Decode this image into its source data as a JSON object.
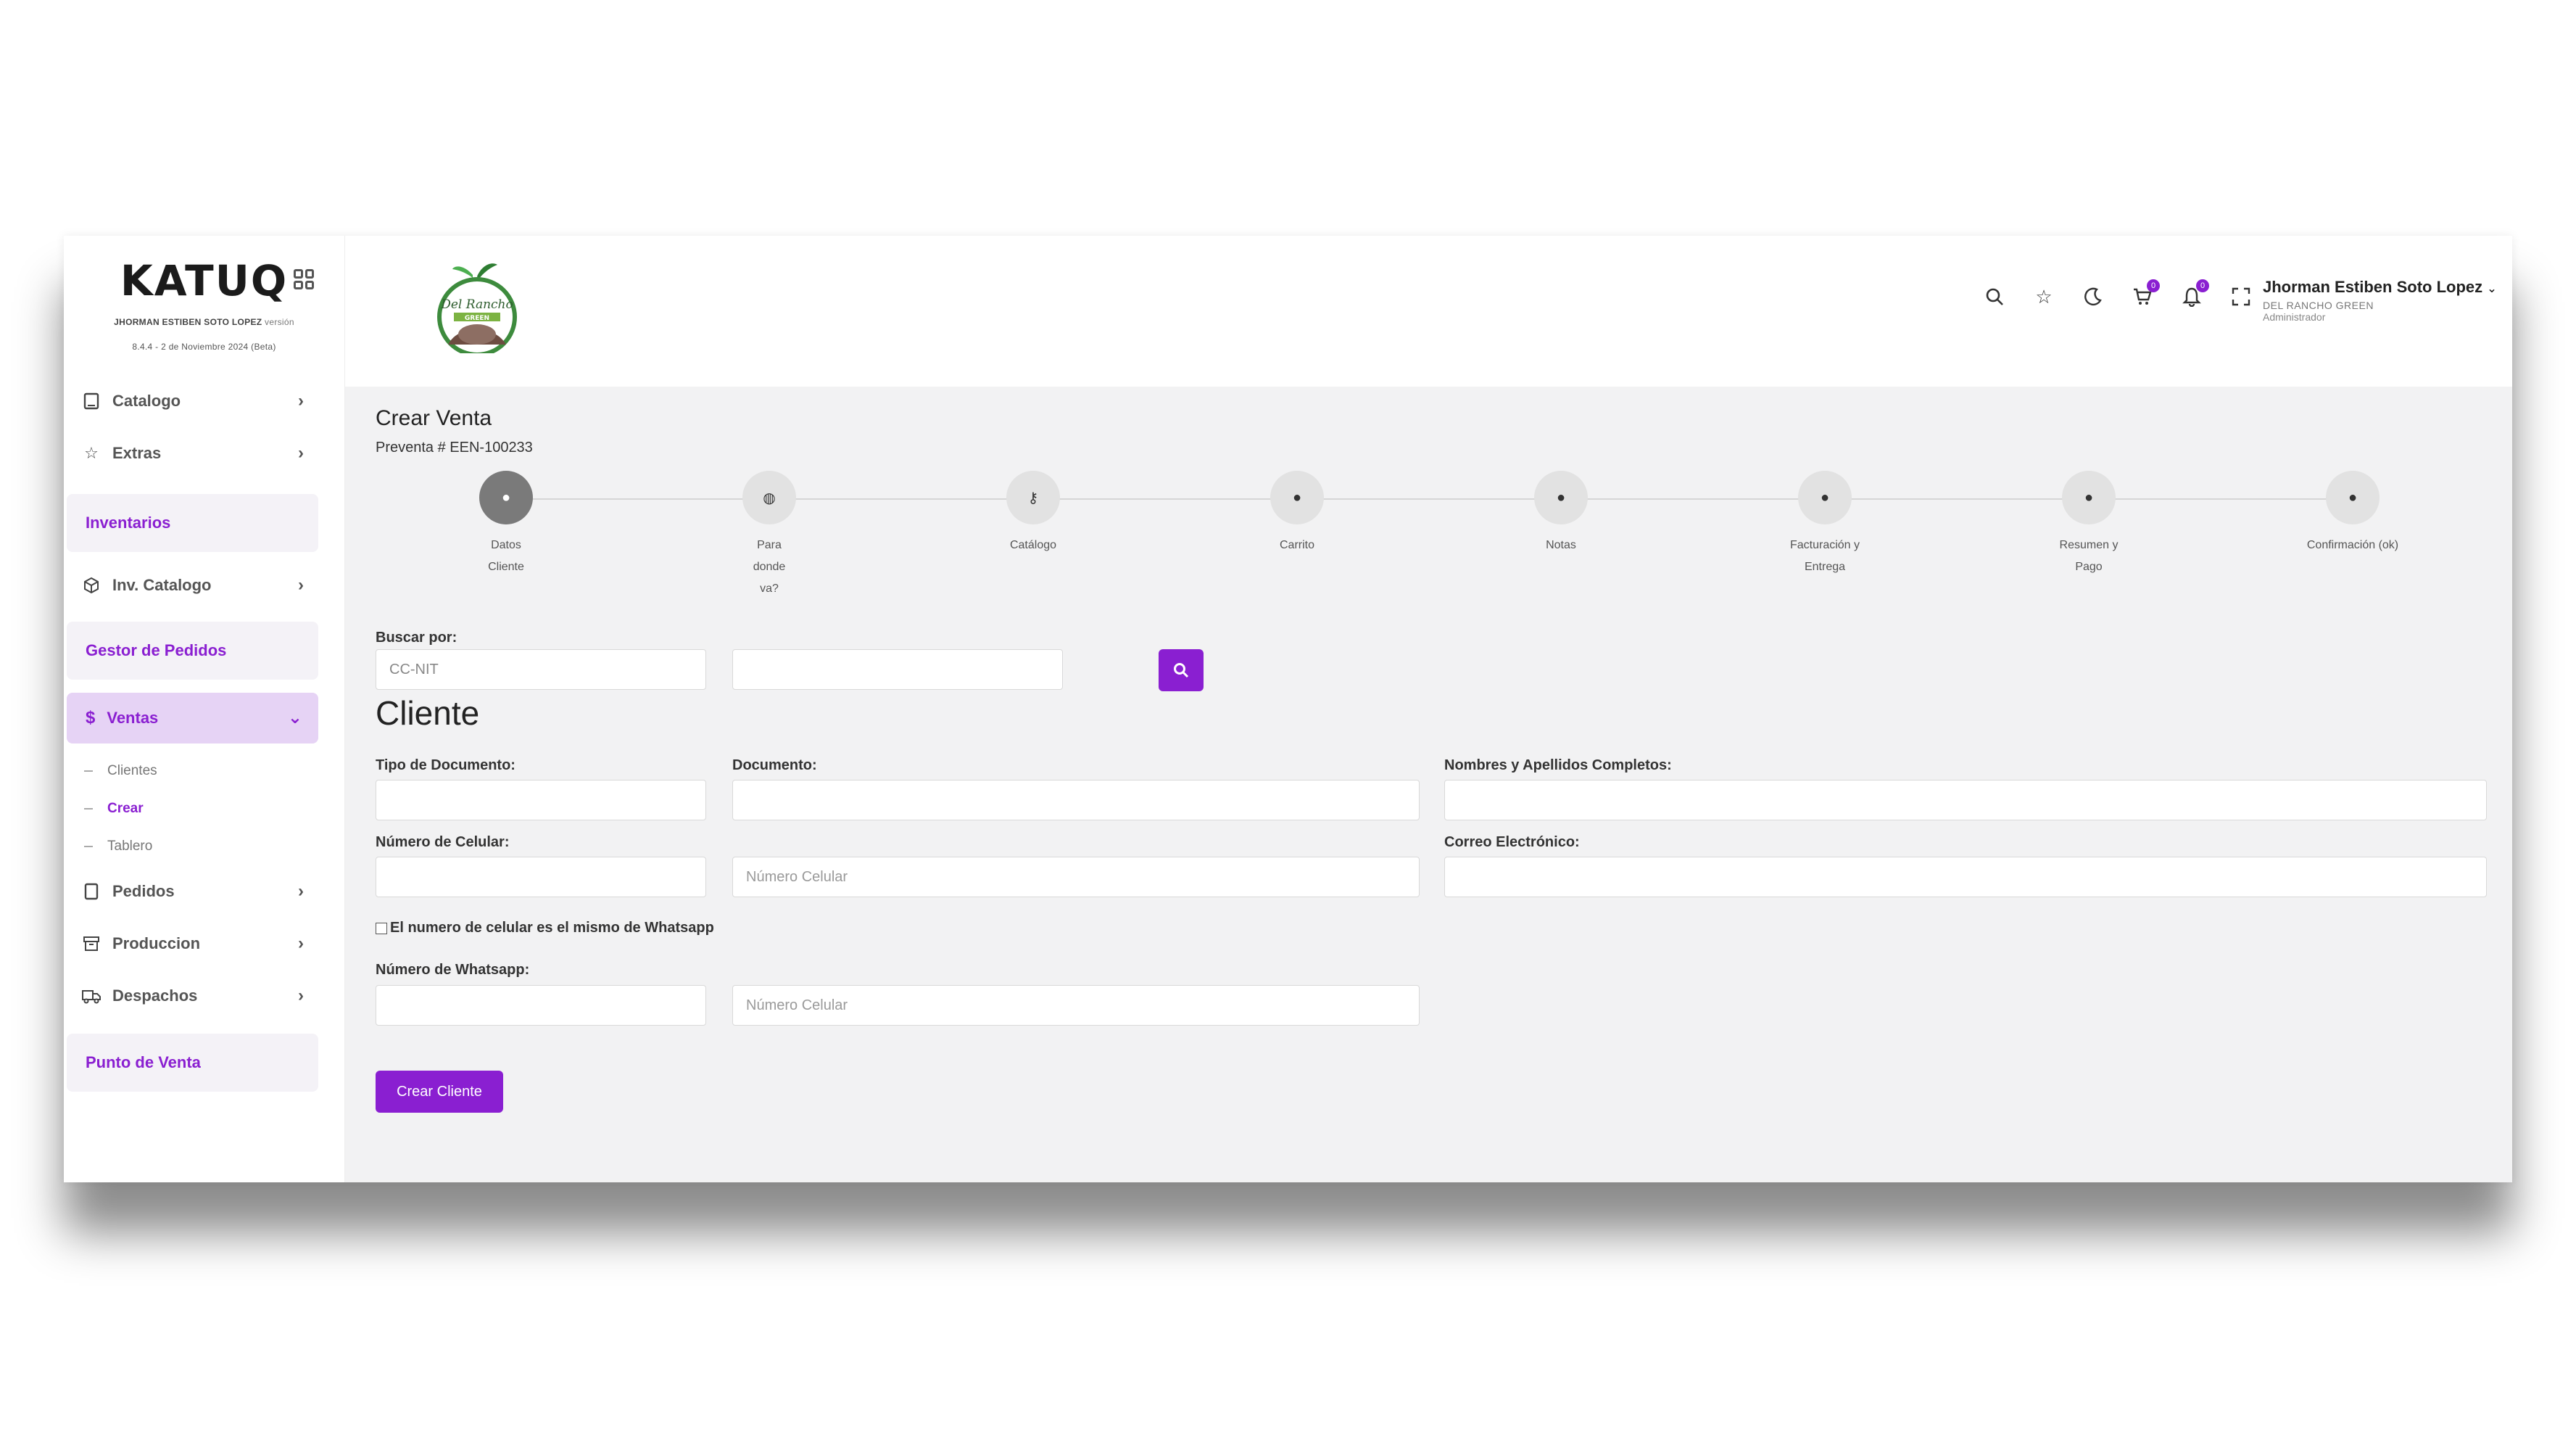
{
  "brand": {
    "logo": "KATUQ",
    "user_line": "JHORMAN ESTIBEN SOTO LOPEZ",
    "version_word": "versión",
    "version": "8.4.4 - 2 de Noviembre 2024 (Beta)"
  },
  "sidebar": {
    "catalogo": "Catalogo",
    "extras": "Extras",
    "inventarios": "Inventarios",
    "inv_catalogo": "Inv. Catalogo",
    "gestor_pedidos": "Gestor de Pedidos",
    "ventas": "Ventas",
    "ventas_sub": [
      "Clientes",
      "Crear",
      "Tablero"
    ],
    "pedidos": "Pedidos",
    "produccion": "Produccion",
    "despachos": "Despachos",
    "punto_venta": "Punto de Venta"
  },
  "header": {
    "store_logo_text": "Del Rancho",
    "store_logo_banner": "GREEN",
    "cart_badge": "0",
    "bell_badge": "0",
    "user_name": "Jhorman Estiben Soto Lopez",
    "user_company": "DEL RANCHO GREEN",
    "user_role": "Administrador"
  },
  "main": {
    "title": "Crear Venta",
    "presale": "Preventa # EEN-100233",
    "steps": [
      {
        "label": "Datos Cliente",
        "icon": "user-icon"
      },
      {
        "label": "Para donde va?",
        "icon": "globe-icon"
      },
      {
        "label": "Catálogo",
        "icon": "key-icon"
      },
      {
        "label": "Carrito",
        "icon": "user-icon"
      },
      {
        "label": "Notas",
        "icon": "user-icon"
      },
      {
        "label": "Facturación y Entrega",
        "icon": "user-icon"
      },
      {
        "label": "Resumen y Pago",
        "icon": "user-icon"
      },
      {
        "label": "Confirmación (ok)",
        "icon": "user-icon"
      }
    ],
    "search_label": "Buscar por:",
    "search_type_value": "CC-NIT",
    "client_title": "Cliente",
    "doc_type_label": "Tipo de Documento:",
    "document_label": "Documento:",
    "full_name_label": "Nombres y Apellidos Completos:",
    "cell_label": "Número de Celular:",
    "cell_placeholder": "Número Celular",
    "email_label": "Correo Electrónico:",
    "same_whatsapp_label": "El numero de celular es el mismo de Whatsapp",
    "whatsapp_label": "Número de Whatsapp:",
    "whatsapp_placeholder": "Número Celular",
    "create_button": "Crear Cliente"
  },
  "colors": {
    "accent": "#8a1fd1",
    "active_bg": "#e6d3f5",
    "content_bg": "#f2f2f3"
  }
}
